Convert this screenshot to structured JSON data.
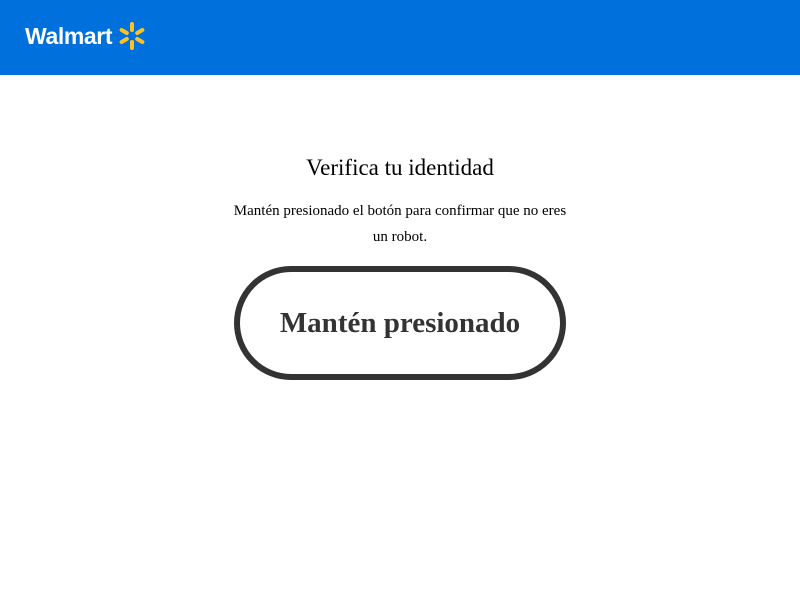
{
  "header": {
    "brand_name": "Walmart",
    "background_color": "#0071dc",
    "spark_icon": "walmart-spark-icon",
    "spark_color": "#ffc220"
  },
  "main": {
    "title": "Verifica tu identidad",
    "subtitle": "Mantén presionado el botón para confirmar que no eres un robot.",
    "hold_button_label": "Mantén presionado",
    "button_border_color": "#333333"
  }
}
